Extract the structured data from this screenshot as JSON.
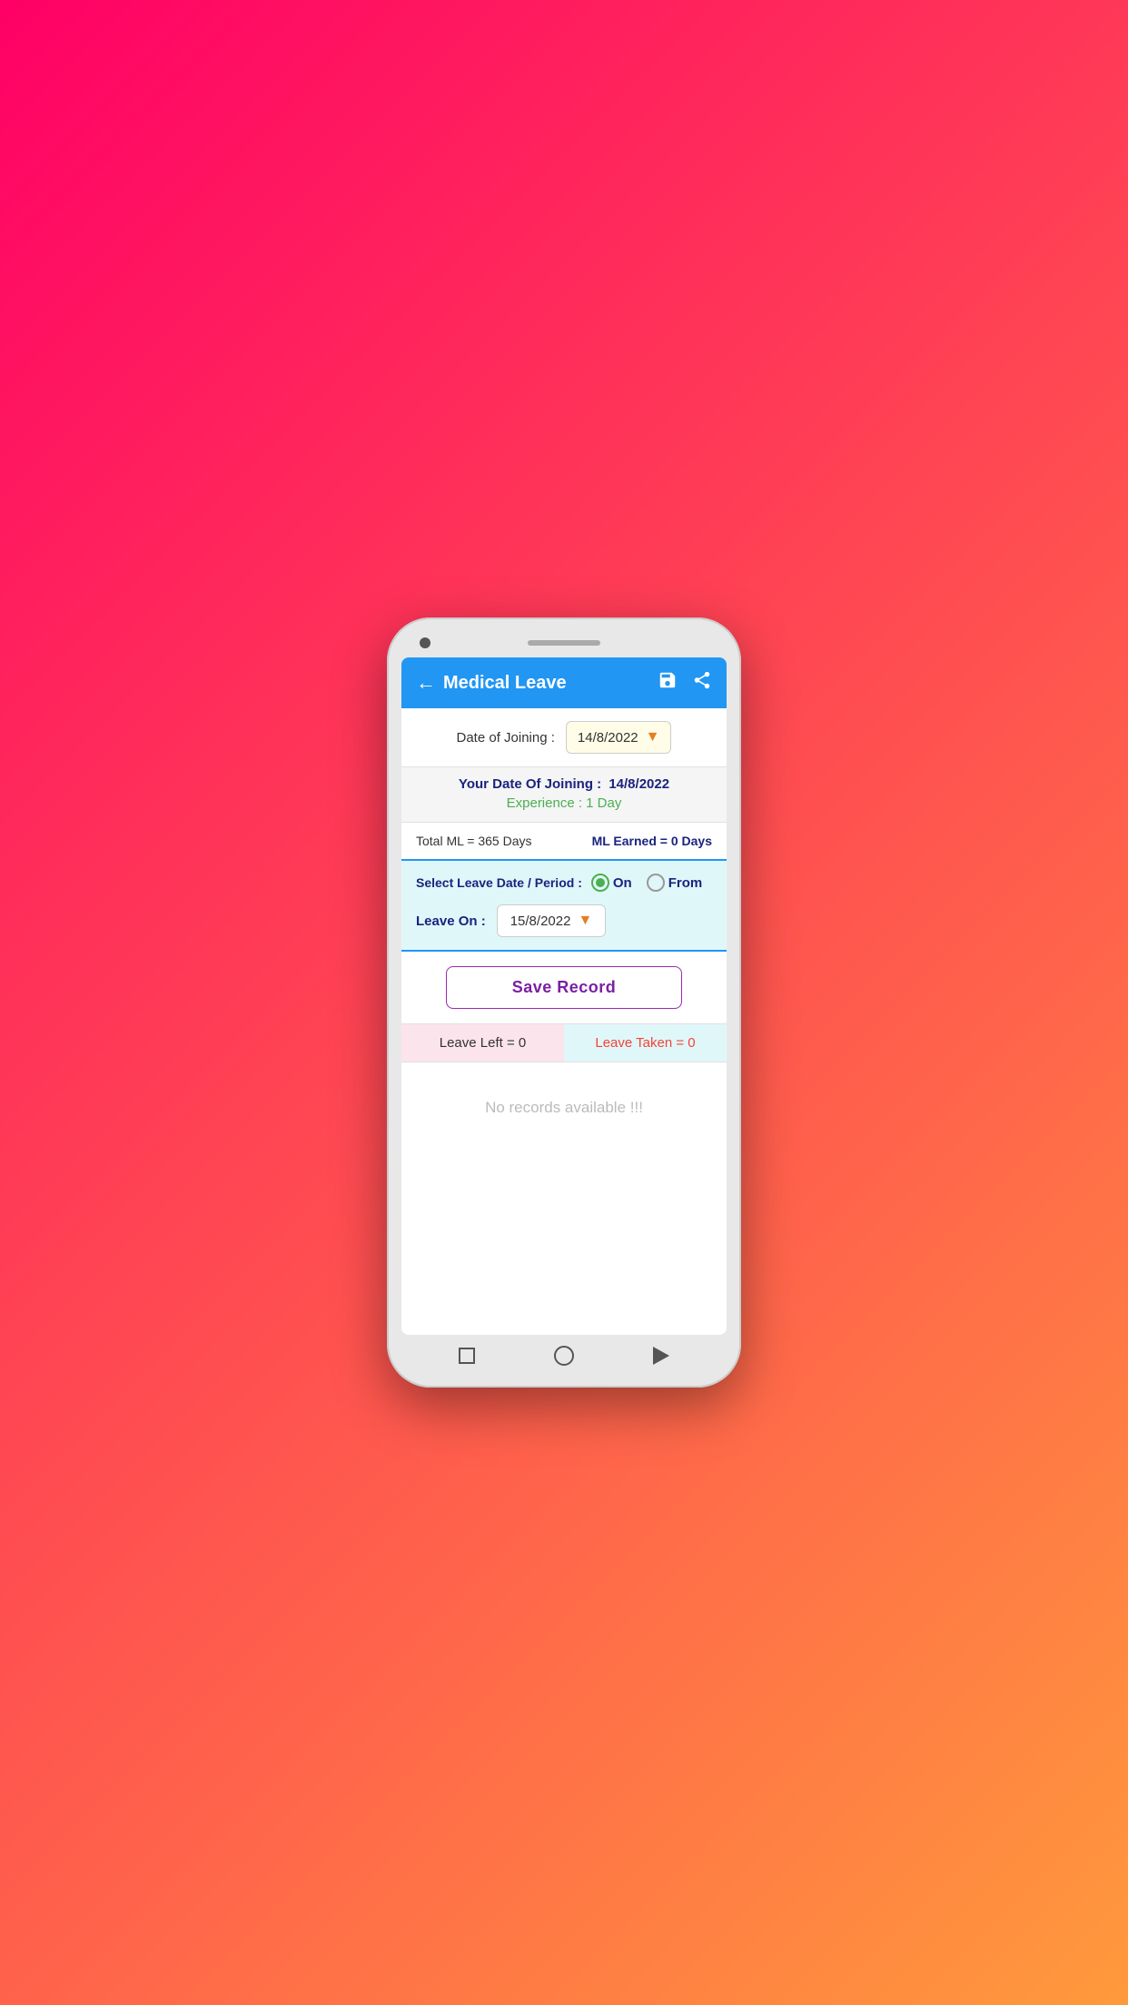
{
  "header": {
    "title": "Medical Leave",
    "back_label": "←",
    "save_icon": "💾",
    "share_icon": "⬆"
  },
  "doj_section": {
    "label": "Date of Joining :",
    "selected_date": "14/8/2022"
  },
  "info_section": {
    "joining_prefix": "Your Date Of Joining :",
    "joining_date": "14/8/2022",
    "experience_label": "Experience : 1 Day"
  },
  "ml_stats": {
    "total_ml": "Total ML = 365 Days",
    "ml_earned": "ML Earned = 0 Days"
  },
  "leave_period": {
    "label": "Select Leave Date / Period :",
    "radio_on_label": "On",
    "radio_from_label": "From",
    "selected_radio": "on"
  },
  "leave_on": {
    "label": "Leave On :",
    "selected_date": "15/8/2022"
  },
  "save_button": {
    "label": "Save Record"
  },
  "leave_stats": {
    "leave_left": "Leave Left =  0",
    "leave_taken": "Leave Taken = 0"
  },
  "empty_state": {
    "message": "No records available !!!"
  }
}
